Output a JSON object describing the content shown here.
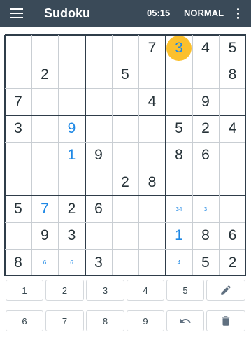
{
  "appbar": {
    "title": "Sudoku",
    "timer": "05:15",
    "difficulty": "NORMAL",
    "menu_icon": "hamburger-menu-icon",
    "more_icon": "more-vert-icon"
  },
  "board": {
    "selected": [
      0,
      6
    ],
    "rows": [
      [
        {
          "v": ""
        },
        {
          "v": ""
        },
        {
          "v": ""
        },
        {
          "v": ""
        },
        {
          "v": ""
        },
        {
          "v": "7",
          "t": "given"
        },
        {
          "v": "3",
          "t": "user"
        },
        {
          "v": "4",
          "t": "given"
        },
        {
          "v": "5",
          "t": "given"
        }
      ],
      [
        {
          "v": ""
        },
        {
          "v": "2",
          "t": "given"
        },
        {
          "v": ""
        },
        {
          "v": ""
        },
        {
          "v": "5",
          "t": "given"
        },
        {
          "v": ""
        },
        {
          "v": ""
        },
        {
          "v": ""
        },
        {
          "v": "8",
          "t": "given"
        }
      ],
      [
        {
          "v": "7",
          "t": "given"
        },
        {
          "v": ""
        },
        {
          "v": ""
        },
        {
          "v": ""
        },
        {
          "v": ""
        },
        {
          "v": "4",
          "t": "given"
        },
        {
          "v": ""
        },
        {
          "v": "9",
          "t": "given"
        },
        {
          "v": ""
        }
      ],
      [
        {
          "v": "3",
          "t": "given"
        },
        {
          "v": ""
        },
        {
          "v": "9",
          "t": "user"
        },
        {
          "v": ""
        },
        {
          "v": ""
        },
        {
          "v": ""
        },
        {
          "v": "5",
          "t": "given"
        },
        {
          "v": "2",
          "t": "given"
        },
        {
          "v": "4",
          "t": "given"
        }
      ],
      [
        {
          "v": ""
        },
        {
          "v": ""
        },
        {
          "v": "1",
          "t": "user"
        },
        {
          "v": "9",
          "t": "given"
        },
        {
          "v": ""
        },
        {
          "v": ""
        },
        {
          "v": "8",
          "t": "given"
        },
        {
          "v": "6",
          "t": "given"
        },
        {
          "v": ""
        }
      ],
      [
        {
          "v": ""
        },
        {
          "v": ""
        },
        {
          "v": ""
        },
        {
          "v": ""
        },
        {
          "v": "2",
          "t": "given"
        },
        {
          "v": "8",
          "t": "given"
        },
        {
          "v": ""
        },
        {
          "v": ""
        },
        {
          "v": ""
        }
      ],
      [
        {
          "v": "5",
          "t": "given"
        },
        {
          "v": "7",
          "t": "user"
        },
        {
          "v": "2",
          "t": "given"
        },
        {
          "v": "6",
          "t": "given"
        },
        {
          "v": ""
        },
        {
          "v": ""
        },
        {
          "v": "34",
          "t": "notes"
        },
        {
          "v": "3",
          "t": "notes"
        },
        {
          "v": ""
        }
      ],
      [
        {
          "v": ""
        },
        {
          "v": "9",
          "t": "given"
        },
        {
          "v": "3",
          "t": "given"
        },
        {
          "v": ""
        },
        {
          "v": ""
        },
        {
          "v": ""
        },
        {
          "v": "1",
          "t": "user"
        },
        {
          "v": "8",
          "t": "given"
        },
        {
          "v": "6",
          "t": "given"
        }
      ],
      [
        {
          "v": "8",
          "t": "given"
        },
        {
          "v": "6",
          "t": "notes"
        },
        {
          "v": "6",
          "t": "notes"
        },
        {
          "v": "3",
          "t": "given"
        },
        {
          "v": ""
        },
        {
          "v": ""
        },
        {
          "v": "4",
          "t": "notes"
        },
        {
          "v": "5",
          "t": "given"
        },
        {
          "v": "2",
          "t": "given"
        }
      ]
    ]
  },
  "keypad": {
    "row1": [
      "1",
      "2",
      "3",
      "4",
      "5"
    ],
    "row2": [
      "6",
      "7",
      "8",
      "9"
    ],
    "pencil_icon": "pencil-icon",
    "undo_icon": "undo-icon",
    "delete_icon": "trash-icon"
  },
  "colors": {
    "appbar": "#3a4a58",
    "user_digit": "#1e88e5",
    "selected_highlight": "#fbc02d",
    "grid_thick": "#2f3d4a",
    "grid_thin": "#c9ced3"
  }
}
